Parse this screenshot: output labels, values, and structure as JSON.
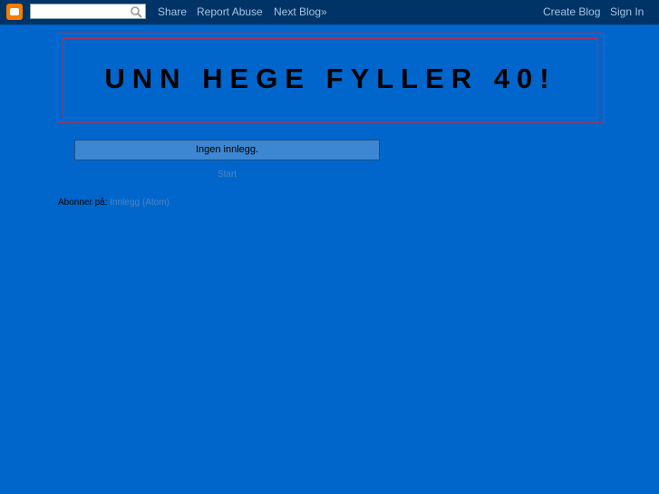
{
  "navbar": {
    "logo_icon": "blogger-logo-icon",
    "search": {
      "value": "",
      "placeholder": "",
      "icon": "search-icon"
    },
    "links": {
      "share": "Share",
      "report_abuse": "Report Abuse",
      "next_blog": "Next Blog»",
      "create_blog": "Create Blog",
      "sign_in": "Sign In"
    }
  },
  "header": {
    "title": "UNN HEGE FYLLER 40!"
  },
  "main": {
    "no_posts": "Ingen innlegg.",
    "home_link": "Start"
  },
  "footer": {
    "subscribe_label": "Abonner på:",
    "feed_link": "Innlegg (Atom)"
  },
  "colors": {
    "background": "#0066cc",
    "navbar": "#003366",
    "header_border": "#b03050",
    "link": "#4e85c0"
  }
}
